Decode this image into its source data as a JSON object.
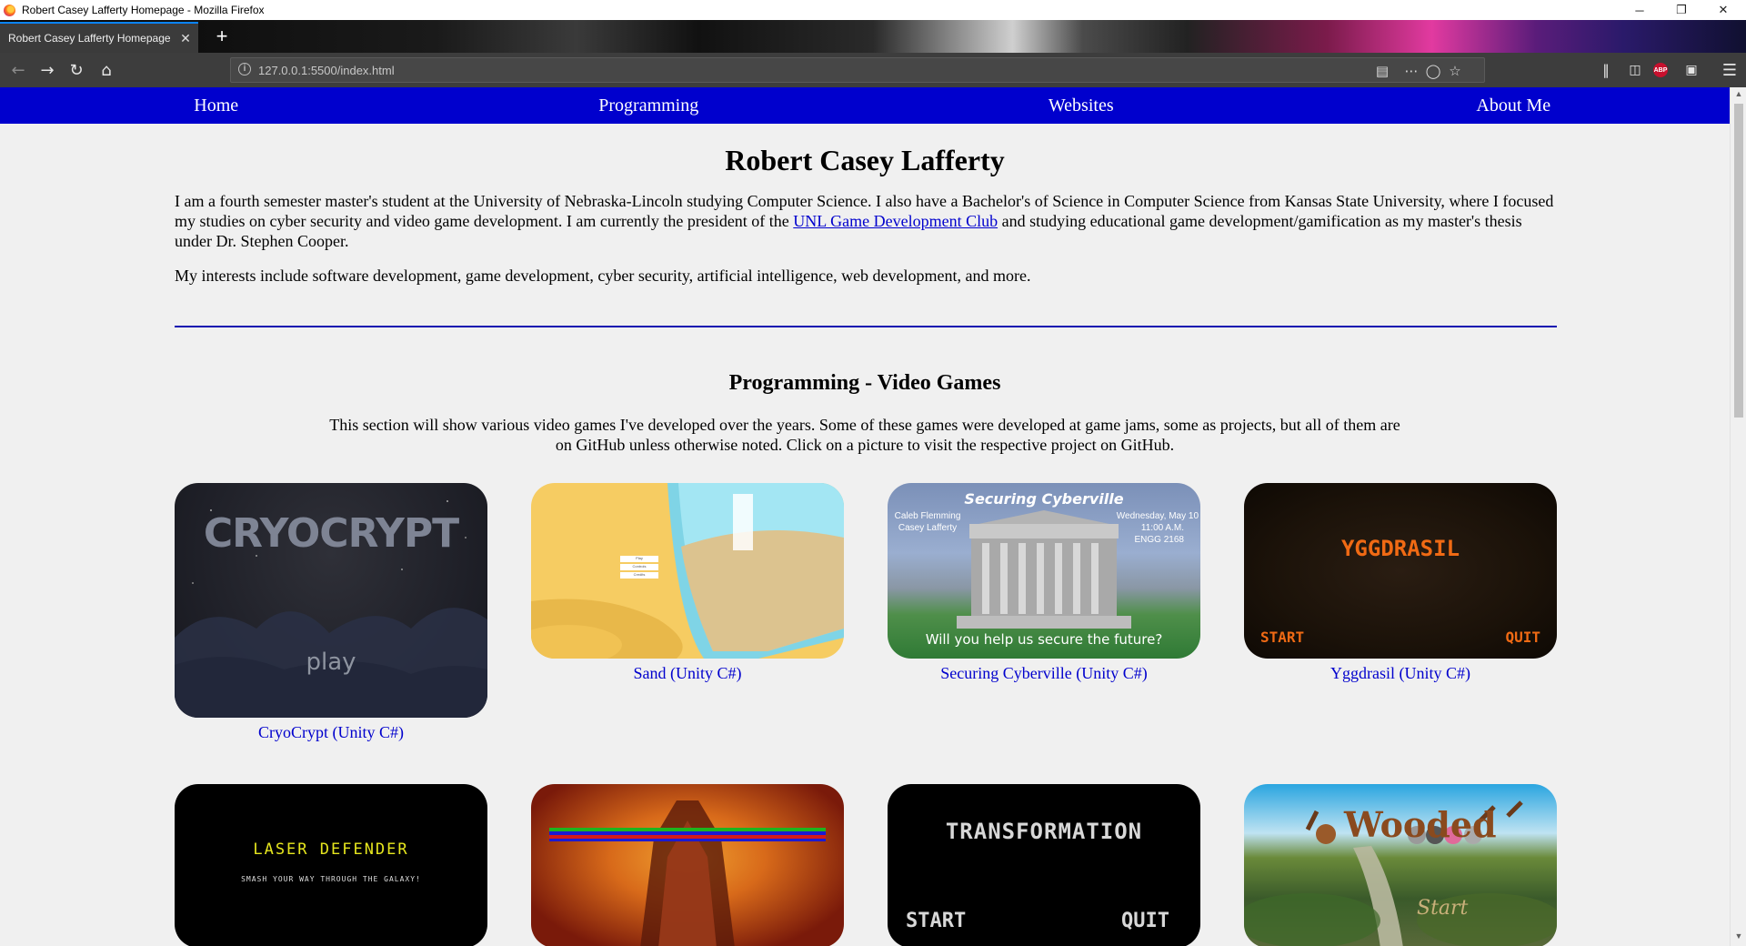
{
  "window": {
    "title": "Robert Casey Lafferty Homepage - Mozilla Firefox",
    "minimize": "─",
    "restore": "❐",
    "close": "✕"
  },
  "tab": {
    "label": "Robert Casey Lafferty Homepage",
    "close": "✕",
    "new_tab": "+"
  },
  "toolbar": {
    "url": "127.0.0.1:5500/index.html",
    "info_glyph": "i",
    "icons": [
      "back-icon",
      "forward-icon",
      "reload-icon",
      "home-icon",
      "reader-view-icon",
      "page-actions-icon",
      "pocket-icon",
      "bookmark-star-icon",
      "library-icon",
      "sidebar-icon",
      "adblock-plus-icon",
      "container-icon",
      "menu-icon"
    ],
    "abp_text": "ABP"
  },
  "nav": {
    "items": [
      "Home",
      "Programming",
      "Websites",
      "About Me"
    ]
  },
  "header": {
    "name": "Robert Casey Lafferty"
  },
  "intro": {
    "p1_before": "I am a fourth semester master's student at the University of Nebraska-Lincoln studying Computer Science. I also have a Bachelor's of Science in Computer Science from Kansas State University, where I focused my studies on cyber security and video game development. I am currently the president of the ",
    "p1_link": "UNL Game Development Club",
    "p1_after": " and studying educational game development/gamification as my master's thesis under Dr. Stephen Cooper.",
    "p2": "My interests include software development, game development, cyber security, artificial intelligence, web development, and more."
  },
  "games": {
    "title": "Programming - Video Games",
    "description": "This section will show various video games I've developed over the years. Some of these games were developed at game jams, some as projects, but all of them are on GitHub unless otherwise noted. Click on a picture to visit the respective project on GitHub.",
    "row1": [
      {
        "caption": "CryoCrypt (Unity C#)",
        "art_title": "CRYOCRYPT",
        "art_sub": "play"
      },
      {
        "caption": "Sand (Unity C#)",
        "art_menu": [
          "Play",
          "Controls",
          "Credits"
        ]
      },
      {
        "caption": "Securing Cyberville (Unity C#)",
        "art_title": "Securing Cyberville",
        "art_left": [
          "Caleb Flemming",
          "Casey Lafferty"
        ],
        "art_right": [
          "Wednesday, May 10",
          "11:00 A.M.",
          "ENGG 2168"
        ],
        "art_sub": "Will you help us secure the future?"
      },
      {
        "caption": "Yggdrasil (Unity C#)",
        "art_title": "YGGDRASIL",
        "art_start": "START",
        "art_quit": "QUIT"
      }
    ],
    "row2": [
      {
        "art_title": "LASER DEFENDER",
        "art_sub": "SMASH YOUR WAY THROUGH THE GALAXY!"
      },
      {},
      {
        "art_title": "TRANSFORMATION",
        "art_start": "START",
        "art_quit": "QUIT"
      },
      {
        "art_title": "Wooded",
        "art_sub": "Start"
      }
    ]
  },
  "colors": {
    "nav_bg": "#0000cd",
    "link": "#0000cd",
    "page_bg": "#f0f0f0",
    "divider": "#1010b0"
  }
}
